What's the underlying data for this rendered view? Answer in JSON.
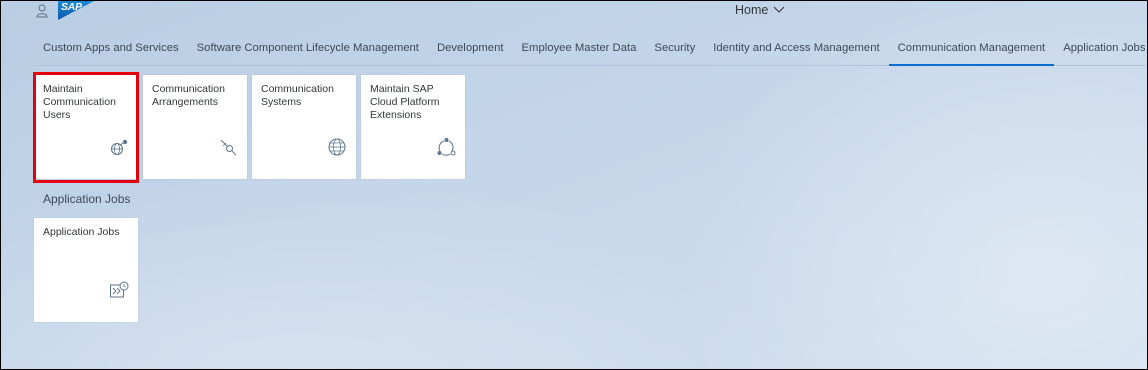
{
  "shell": {
    "logo_text": "SAP",
    "home_label": "Home",
    "user_icon": "person-icon",
    "menu_icon": "chevron-down-icon"
  },
  "tabs": [
    {
      "label": "Custom Apps and Services",
      "selected": false
    },
    {
      "label": "Software Component Lifecycle Management",
      "selected": false
    },
    {
      "label": "Development",
      "selected": false
    },
    {
      "label": "Employee Master Data",
      "selected": false
    },
    {
      "label": "Security",
      "selected": false
    },
    {
      "label": "Identity and Access Management",
      "selected": false
    },
    {
      "label": "Communication Management",
      "selected": true
    },
    {
      "label": "Application Jobs",
      "selected": false
    }
  ],
  "tiles_group1": [
    {
      "title": "Maintain Communication Users",
      "icon": "globe-user-icon",
      "highlighted": true
    },
    {
      "title": "Communication Arrangements",
      "icon": "plug-connection-icon"
    },
    {
      "title": "Communication Systems",
      "icon": "globe-icon"
    },
    {
      "title": "Maintain SAP Cloud Platform Extensions",
      "icon": "cycle-network-icon"
    }
  ],
  "group2": {
    "title": "Application Jobs",
    "tiles": [
      {
        "title": "Application Jobs",
        "icon": "job-schedule-icon"
      }
    ]
  },
  "colors": {
    "accent": "#0a6ed1",
    "highlight": "#e5000d",
    "icon": "#5b738b"
  }
}
